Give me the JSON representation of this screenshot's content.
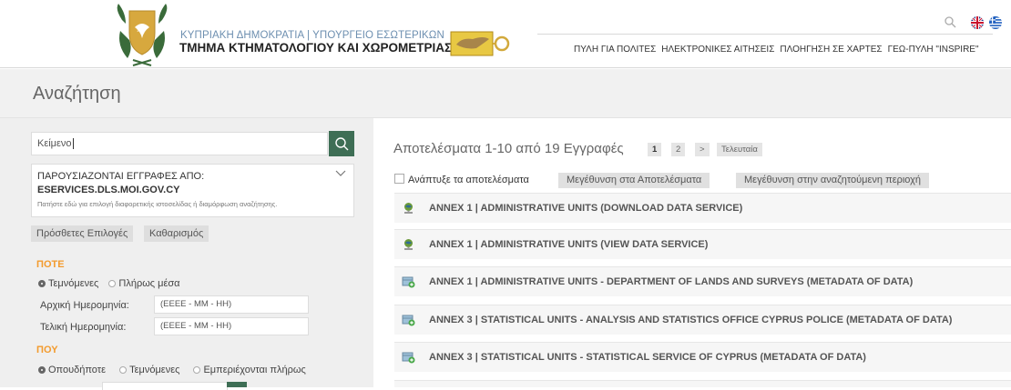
{
  "header": {
    "ministry": "ΚΥΠΡΙΑΚΗ ΔΗΜΟΚΡΑΤΙΑ | ΥΠΟΥΡΓΕΙΟ ΕΣΩΤΕΡΙΚΩΝ",
    "department": "ΤΜΗΜΑ ΚΤΗΜΑΤΟΛΟΓΙΟΥ ΚΑΙ ΧΩΡΟΜΕΤΡΙΑΣ",
    "nav": [
      "ΠΥΛΗ ΓΙΑ ΠΟΛΙΤΕΣ",
      "ΗΛΕΚΤΡΟΝΙΚΕΣ ΑΙΤΗΣΕΙΣ",
      "ΠΛΟΗΓΗΣΗ ΣΕ ΧΑΡΤΕΣ",
      "ΓΕΩ-ΠΥΛΗ \"INSPIRE\""
    ]
  },
  "page_title": "Αναζήτηση",
  "filters": {
    "search_label": "Κείμενο",
    "source_heading": "ΠΑΡΟΥΣΙΑΖΟΝΤΑΙ ΕΓΓΡΑΦΕΣ ΑΠΟ:",
    "source_value": "ESERVICES.DLS.MOI.GOV.CY",
    "source_hint": "Πατήστε εδώ για επιλογή διαφορετικής ιστοσελίδας ή διαμόρφωση αναζήτησης.",
    "more_options": "Πρόσθετες Επιλογές",
    "clear": "Καθαρισμός",
    "when_heading": "ΠΟΤΕ",
    "when_opt1": "Τεμνόμενες",
    "when_opt2": "Πλήρως μέσα",
    "start_label": "Αρχική Ημερομηνία:",
    "end_label": "Τελική Ημερομηνία:",
    "date_placeholder": "(ΕΕΕΕ - ΜΜ - ΗΗ)",
    "where_heading": "ΠΟΥ",
    "where_opt1": "Οπουδήποτε",
    "where_opt2": "Τεμνόμενες",
    "where_opt3": "Εμπεριέχονται πλήρως"
  },
  "results": {
    "summary": "Αποτελέσματα 1-10 από 19 Εγγραφές",
    "pages": [
      "1",
      "2",
      ">",
      "Τελευταία"
    ],
    "expand_label": "Ανάπτυξε τα αποτελέσματα",
    "zoom_results": "Μεγέθυνση στα Αποτελέσματα",
    "zoom_area": "Μεγέθυνση στην αναζητούμενη περιοχή",
    "items": [
      {
        "title": "ANNEX 1 | ADMINISTRATIVE UNITS (DOWNLOAD DATA SERVICE)",
        "icon": "service-icon"
      },
      {
        "title": "ANNEX 1 | ADMINISTRATIVE UNITS (VIEW DATA SERVICE)",
        "icon": "service-icon"
      },
      {
        "title": "ANNEX 1 | ADMINISTRATIVE UNITS - DEPARTMENT OF LANDS AND SURVEYS (METADATA OF DATA)",
        "icon": "dataset-icon"
      },
      {
        "title": "ANNEX 3 | STATISTICAL UNITS - ANALYSIS AND STATISTICS OFFICE CYPRUS POLICE (METADATA OF DATA)",
        "icon": "dataset-icon"
      },
      {
        "title": "ANNEX 3 | STATISTICAL UNITS - STATISTICAL SERVICE OF CYPRUS (METADATA OF DATA)",
        "icon": "dataset-icon"
      }
    ]
  },
  "colors": {
    "accent": "#f39b2e",
    "button": "#3e6e55",
    "ministry_text": "#6d8fb0"
  }
}
